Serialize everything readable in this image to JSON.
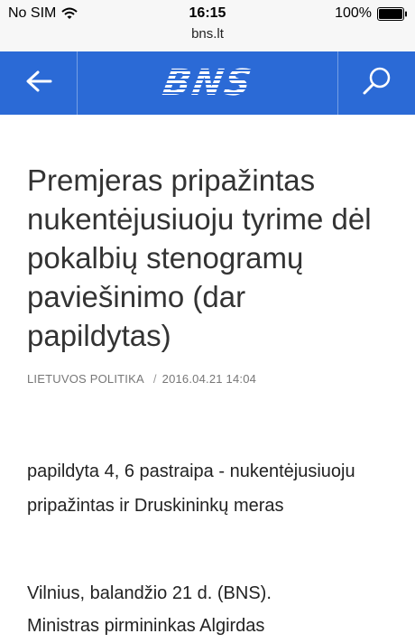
{
  "status_bar": {
    "carrier": "No SIM",
    "time": "16:15",
    "battery": "100%"
  },
  "browser": {
    "url": "bns.lt"
  },
  "header": {
    "logo_text": "BNS",
    "back_icon": "arrow-left-icon",
    "search_icon": "search-icon",
    "accent_color": "#2b6ad6"
  },
  "article": {
    "title": "Premjeras pripažintas nukentėjusiuoju tyrime dėl pokalbių stenogramų paviešinimo (dar papildytas)",
    "category": "LIETUVOS POLITIKA",
    "separator": "/",
    "date": "2016.04.21 14:04",
    "update_note": "papildyta 4, 6 pastraipa - nukentėjusiuoju pripažintas ir Druskininkų meras",
    "lead_line1": "Vilnius, balandžio 21 d. (BNS).",
    "lead_line2": "Ministras pirmininkas Algirdas"
  }
}
